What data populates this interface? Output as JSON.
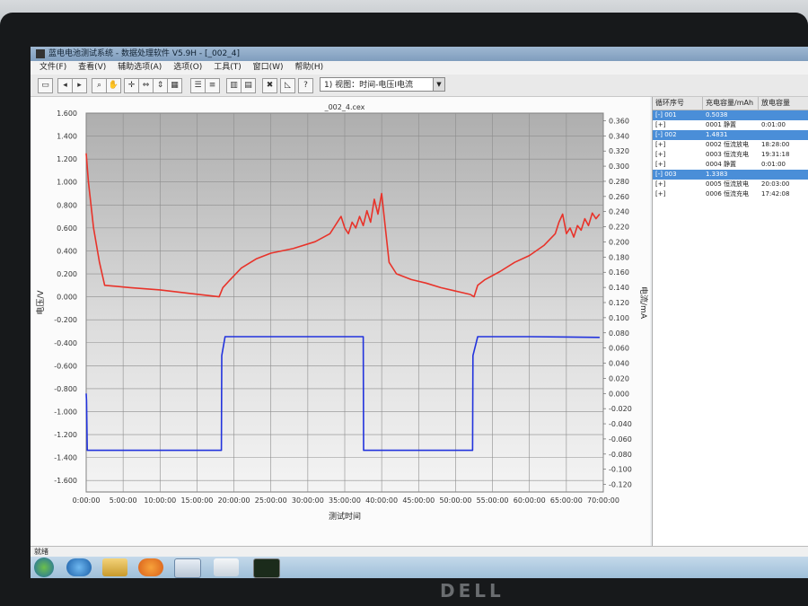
{
  "window": {
    "title": "蓝电电池测试系统 - 数据处理软件 V5.9H - [_002_4]"
  },
  "menu": [
    "文件(F)",
    "查看(V)",
    "辅助选项(A)",
    "选项(O)",
    "工具(T)",
    "窗口(W)",
    "帮助(H)"
  ],
  "toolbar": {
    "view_select": "1) 视图：时间-电压I电流"
  },
  "chart_data": {
    "type": "line",
    "title": "_002_4.cex",
    "xlabel": "测试时间",
    "ylabel_left": "电压/V",
    "ylabel_right": "电流/mA",
    "x_ticks": [
      "0:00:00",
      "5:00:00",
      "10:00:00",
      "15:00:00",
      "20:00:00",
      "25:00:00",
      "30:00:00",
      "35:00:00",
      "40:00:00",
      "45:00:00",
      "50:00:00",
      "55:00:00",
      "60:00:00",
      "65:00:00",
      "70:00:00"
    ],
    "y_left_ticks": [
      "1.600",
      "1.400",
      "1.200",
      "1.000",
      "0.800",
      "0.600",
      "0.400",
      "0.200",
      "0.000",
      "-0.200",
      "-0.400",
      "-0.600",
      "-0.800",
      "-1.000",
      "-1.200",
      "-1.400",
      "-1.600"
    ],
    "y_right_ticks": [
      "0.360",
      "0.340",
      "0.320",
      "0.300",
      "0.280",
      "0.260",
      "0.240",
      "0.220",
      "0.200",
      "0.180",
      "0.160",
      "0.140",
      "0.120",
      "0.100",
      "0.080",
      "0.060",
      "0.040",
      "0.020",
      "0.000",
      "-0.020",
      "-0.040",
      "-0.060",
      "-0.080",
      "-0.100",
      "-0.120"
    ],
    "xlim": [
      0,
      70
    ],
    "ylim_left": [
      -1.7,
      1.6
    ],
    "ylim_right": [
      -0.13,
      0.37
    ],
    "grid": true,
    "series": [
      {
        "axis": "left",
        "color": "#e8332a",
        "x": [
          0,
          0.3,
          1,
          1.8,
          2.5,
          6,
          10,
          14,
          18,
          18.5,
          19.5,
          21,
          23,
          25,
          28,
          31,
          33,
          34.5,
          35,
          35.5,
          36,
          36.5,
          37,
          37.5,
          38,
          38.5,
          39,
          39.5,
          40,
          41,
          42,
          44,
          46,
          48,
          50,
          52,
          52.5,
          53,
          54,
          56,
          58,
          60,
          62,
          63.5,
          64,
          64.5,
          65,
          65.5,
          66,
          66.5,
          67,
          67.5,
          68,
          68.5,
          69,
          69.5
        ],
        "y": [
          1.25,
          1.0,
          0.6,
          0.3,
          0.1,
          0.08,
          0.06,
          0.03,
          0.0,
          0.08,
          0.15,
          0.25,
          0.33,
          0.38,
          0.42,
          0.48,
          0.55,
          0.7,
          0.6,
          0.55,
          0.65,
          0.6,
          0.7,
          0.62,
          0.75,
          0.65,
          0.85,
          0.72,
          0.9,
          0.3,
          0.2,
          0.15,
          0.12,
          0.08,
          0.05,
          0.02,
          0.0,
          0.1,
          0.15,
          0.22,
          0.3,
          0.36,
          0.45,
          0.55,
          0.65,
          0.72,
          0.55,
          0.6,
          0.52,
          0.62,
          0.58,
          0.68,
          0.62,
          0.73,
          0.68,
          0.72
        ]
      },
      {
        "axis": "right",
        "color": "#2233dd",
        "x": [
          0,
          0.05,
          0.15,
          18.3,
          18.35,
          18.8,
          37.5,
          37.55,
          52.3,
          52.35,
          53,
          60,
          69.5
        ],
        "y": [
          0.0,
          -0.01,
          -0.075,
          -0.075,
          0.05,
          0.075,
          0.075,
          -0.075,
          -0.075,
          0.05,
          0.075,
          0.075,
          0.074
        ]
      }
    ]
  },
  "right_panel": {
    "headers": [
      "循环序号",
      "充电容量/mAh",
      "放电容量"
    ],
    "rows": [
      {
        "c1": "[-]  001",
        "c2": "0.5038",
        "c3": "",
        "selected": true
      },
      {
        "c1": "[+]",
        "c2": "0001 静置",
        "c3": "0:01:00",
        "selected": false
      },
      {
        "c1": "[-]  002",
        "c2": "1.4831",
        "c3": "",
        "selected": true
      },
      {
        "c1": "[+]",
        "c2": "0002 恒流放电",
        "c3": "18:28:00",
        "selected": false
      },
      {
        "c1": "[+]",
        "c2": "0003 恒流充电",
        "c3": "19:31:18",
        "selected": false
      },
      {
        "c1": "[+]",
        "c2": "0004 静置",
        "c3": "0:01:00",
        "selected": false
      },
      {
        "c1": "[-]  003",
        "c2": "1.3383",
        "c3": "",
        "selected": true
      },
      {
        "c1": "[+]",
        "c2": "0005 恒流放电",
        "c3": "20:03:00",
        "selected": false
      },
      {
        "c1": "[+]",
        "c2": "0006 恒流充电",
        "c3": "17:42:08",
        "selected": false
      }
    ]
  },
  "status": {
    "text": "就绪"
  },
  "taskbar": {
    "items": [
      "start-orb",
      "ie",
      "explorer",
      "media-player",
      "battery-app",
      "document",
      "oscilloscope"
    ]
  },
  "brand": {
    "logo": "DELL"
  }
}
